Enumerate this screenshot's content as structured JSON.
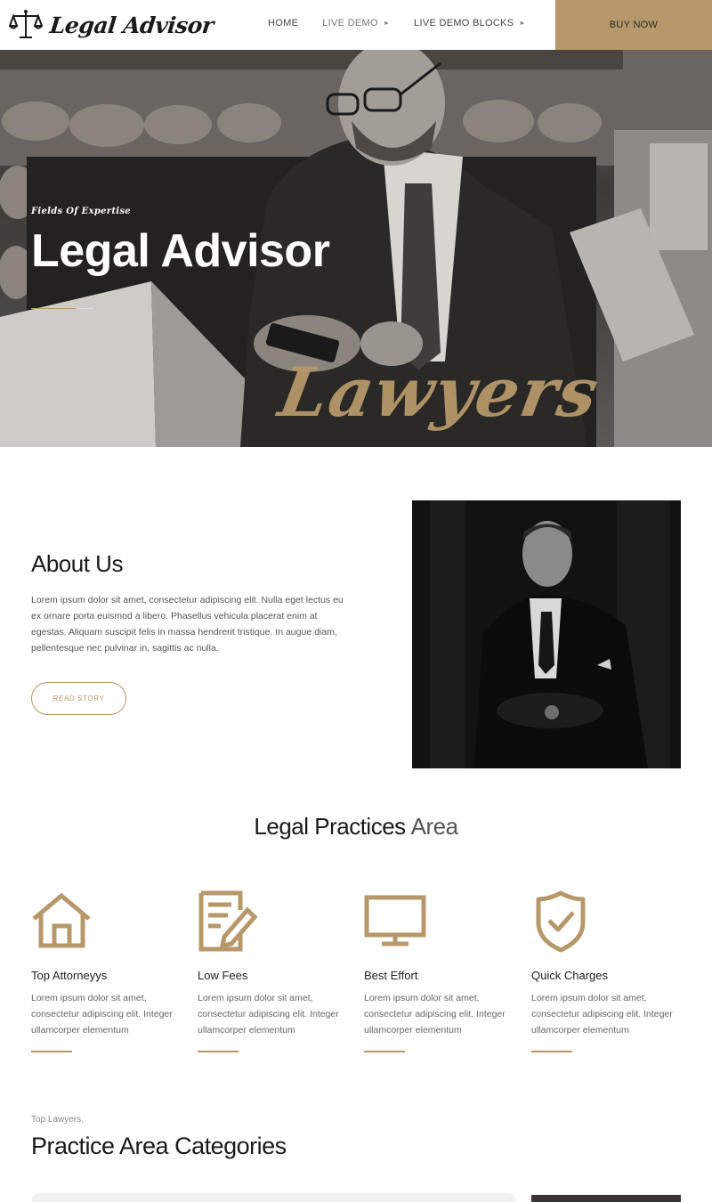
{
  "header": {
    "logo_text": "Legal Advisor",
    "nav": [
      {
        "label": "HOME",
        "has_caret": false
      },
      {
        "label": "LIVE DEMO",
        "has_caret": true
      },
      {
        "label": "LIVE DEMO BLOCKS",
        "has_caret": true
      }
    ],
    "buy_label": "BUY NOW"
  },
  "hero": {
    "kicker": "Fields Of Expertise",
    "title": "Legal Advisor",
    "script_word": "Lawyers"
  },
  "about": {
    "title": "About Us",
    "text": "Lorem ipsum dolor sit amet, consectetur adipiscing elit. Nulla eget lectus eu ex ornare porta euismod a libero. Phasellus vehicula placerat enim at egestas. Aliquam suscipit felis in massa hendrerit tristique. In augue diam, pellentesque nec pulvinar in, sagittis ac nulla.",
    "button": "READ STORY"
  },
  "practices": {
    "title_strong": "Legal Practices",
    "title_light": "Area",
    "cards": [
      {
        "icon": "house-icon",
        "title": "Top Attorneyys",
        "text": "Lorem ipsum dolor sit amet, consectetur adipiscing elit. Integer ullamcorper elementum"
      },
      {
        "icon": "document-pen-icon",
        "title": "Low Fees",
        "text": "Lorem ipsum dolor sit amet, consectetur adipiscing elit. Integer ullamcorper elementum"
      },
      {
        "icon": "monitor-icon",
        "title": "Best Effort",
        "text": "Lorem ipsum dolor sit amet, consectetur adipiscing elit. Integer ullamcorper elementum"
      },
      {
        "icon": "shield-check-icon",
        "title": "Quick Charges",
        "text": "Lorem ipsum dolor sit amet, consectetur adipiscing elit. Integer ullamcorper elementum"
      }
    ]
  },
  "categories": {
    "kicker": "Top Lawyers.",
    "title": "Practice Area Categories"
  },
  "colors": {
    "accent": "#b6986a",
    "text": "#1a1a1a"
  }
}
